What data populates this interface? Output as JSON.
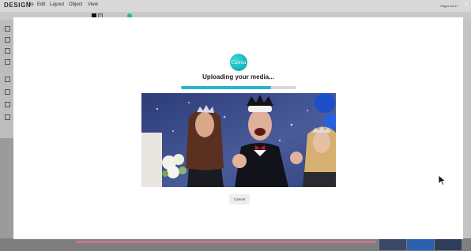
{
  "app": {
    "logo": "DESIGN",
    "menu": [
      "File",
      "Edit",
      "Layout",
      "Object",
      "View"
    ],
    "pages_text": "Pages 16-17",
    "close_glyph": "×"
  },
  "modal": {
    "brand_logo_text": "Canva",
    "title": "Uploading your media...",
    "progress": 0.78,
    "cancel_label": "Cancel"
  },
  "colors": {
    "accent": "#2ab4ca",
    "brand": "#00c4cc",
    "progress_track": "#d8d8d8"
  },
  "icons": {
    "cursor": "mouse-pointer-icon",
    "close": "close-icon"
  }
}
